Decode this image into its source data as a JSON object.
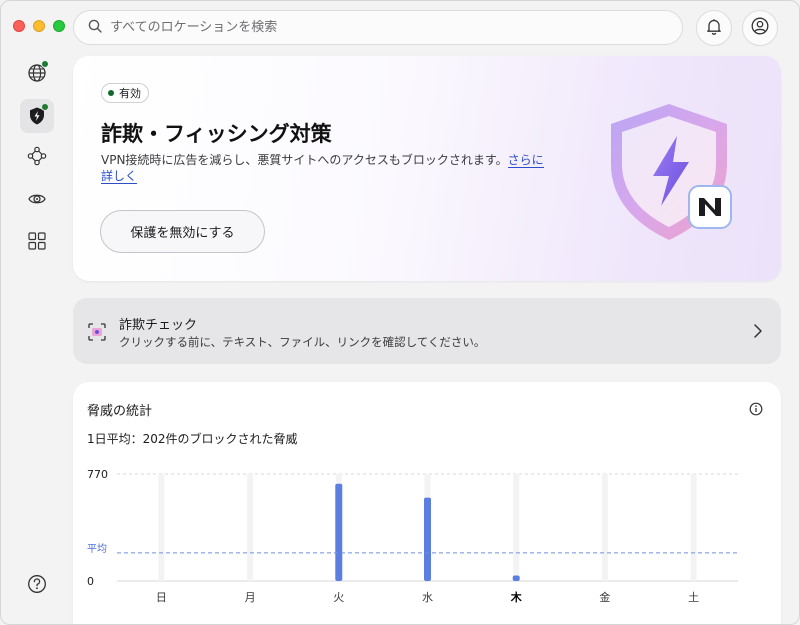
{
  "search": {
    "placeholder": "すべてのロケーションを検索"
  },
  "hero": {
    "badge": "有効",
    "title": "詐欺・フィッシング対策",
    "description": "VPN接続時に広告を減らし、悪質サイトへのアクセスもブロックされます。",
    "learn_more": "さらに詳しく",
    "disable_button": "保護を無効にする"
  },
  "scam_check": {
    "title": "詐欺チェック",
    "subtitle": "クリックする前に、テキスト、ファイル、リンクを確認してください。"
  },
  "stats": {
    "title": "脅威の統計",
    "average": "1日平均：202件のブロックされた脅威"
  },
  "colors": {
    "accent": "#2c4fc8",
    "bar": "#5b7fe0",
    "active_green": "#0d6b2c"
  },
  "chart_data": {
    "type": "bar",
    "categories": [
      "日",
      "月",
      "火",
      "水",
      "木",
      "金",
      "土"
    ],
    "values": [
      0,
      0,
      700,
      600,
      40,
      0,
      0
    ],
    "average": 202,
    "average_label": "平均",
    "ylim": [
      0,
      770
    ],
    "ytick_labels": [
      "770",
      "0"
    ],
    "highlight_category": "木",
    "grid": true
  }
}
